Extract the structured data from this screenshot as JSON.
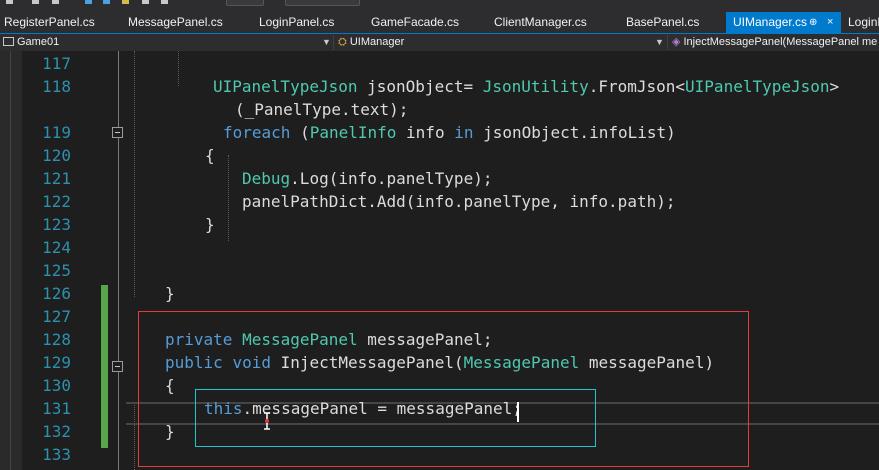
{
  "tabs": [
    {
      "label": "RegisterPanel.cs",
      "active": false
    },
    {
      "label": "MessagePanel.cs",
      "active": false
    },
    {
      "label": "LoginPanel.cs",
      "active": false
    },
    {
      "label": "GameFacade.cs",
      "active": false
    },
    {
      "label": "ClientManager.cs",
      "active": false
    },
    {
      "label": "BasePanel.cs",
      "active": false
    },
    {
      "label": "UIManager.cs",
      "active": true,
      "pin": "⊕",
      "close": "×"
    },
    {
      "label": "LoginB",
      "active": false
    }
  ],
  "nav": {
    "project": "Game01",
    "class": "UIManager",
    "member": "InjectMessagePanel(MessagePanel me"
  },
  "lines": [
    {
      "num": "117",
      "tokens": []
    },
    {
      "num": "118",
      "tokens": [
        {
          "t": "UIPanelTypeJson",
          "c": "ty"
        },
        {
          "t": " jsonObject= ",
          "c": "pn"
        },
        {
          "t": "JsonUtility",
          "c": "ty"
        },
        {
          "t": ".FromJson<",
          "c": "pn"
        },
        {
          "t": "UIPanelTypeJson",
          "c": "ty"
        },
        {
          "t": ">",
          "c": "pn"
        }
      ]
    },
    {
      "num": "",
      "tokens": [
        {
          "t": "(_PanelType.text);",
          "c": "pn"
        }
      ]
    },
    {
      "num": "119",
      "tokens": [
        {
          "t": "foreach",
          "c": "kw"
        },
        {
          "t": " (",
          "c": "pn"
        },
        {
          "t": "PanelInfo",
          "c": "ty"
        },
        {
          "t": " info ",
          "c": "pn"
        },
        {
          "t": "in",
          "c": "kw"
        },
        {
          "t": " jsonObject.infoList)",
          "c": "pn"
        }
      ]
    },
    {
      "num": "120",
      "tokens": [
        {
          "t": "{",
          "c": "pn"
        }
      ]
    },
    {
      "num": "121",
      "tokens": [
        {
          "t": "Debug",
          "c": "ty"
        },
        {
          "t": ".Log(info.panelType);",
          "c": "pn"
        }
      ]
    },
    {
      "num": "122",
      "tokens": [
        {
          "t": "panelPathDict.Add(info.panelType, info.path);",
          "c": "pn"
        }
      ]
    },
    {
      "num": "123",
      "tokens": [
        {
          "t": "}",
          "c": "pn"
        }
      ]
    },
    {
      "num": "124",
      "tokens": []
    },
    {
      "num": "125",
      "tokens": []
    },
    {
      "num": "126",
      "tokens": [
        {
          "t": "}",
          "c": "pn"
        }
      ]
    },
    {
      "num": "127",
      "tokens": []
    },
    {
      "num": "128",
      "tokens": [
        {
          "t": "private",
          "c": "kw"
        },
        {
          "t": " ",
          "c": "pn"
        },
        {
          "t": "MessagePanel",
          "c": "ty"
        },
        {
          "t": " messagePanel;",
          "c": "pn"
        }
      ]
    },
    {
      "num": "129",
      "tokens": [
        {
          "t": "public",
          "c": "kw"
        },
        {
          "t": " ",
          "c": "pn"
        },
        {
          "t": "void",
          "c": "kw"
        },
        {
          "t": " InjectMessagePanel(",
          "c": "pn"
        },
        {
          "t": "MessagePanel",
          "c": "ty"
        },
        {
          "t": " messagePanel)",
          "c": "pn"
        }
      ]
    },
    {
      "num": "130",
      "tokens": [
        {
          "t": "{",
          "c": "pn"
        }
      ]
    },
    {
      "num": "131",
      "tokens": [
        {
          "t": "this",
          "c": "kw"
        },
        {
          "t": ".messagePanel = messagePanel;",
          "c": "pn"
        }
      ]
    },
    {
      "num": "132",
      "tokens": [
        {
          "t": "}",
          "c": "pn"
        }
      ]
    },
    {
      "num": "133",
      "tokens": []
    }
  ]
}
